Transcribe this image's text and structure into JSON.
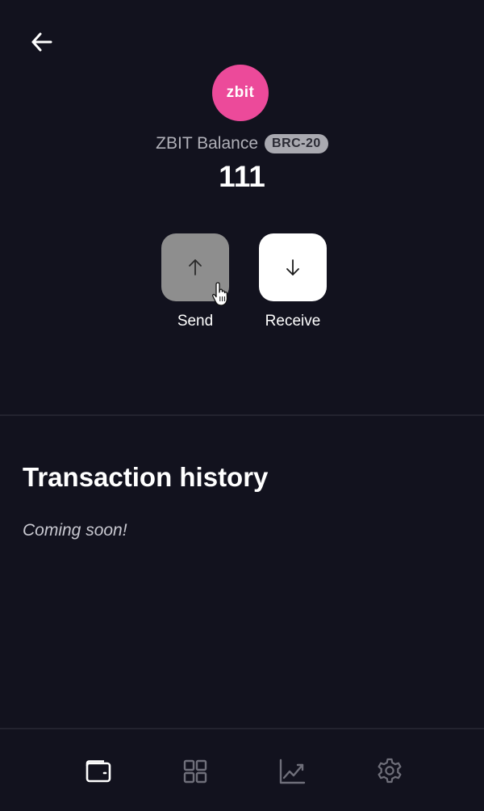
{
  "header": {
    "back_icon": "arrow-left-icon"
  },
  "token": {
    "logo_text": "zbit",
    "logo_color": "#ec4a9a",
    "balance_label": "ZBIT Balance",
    "standard_badge": "BRC-20",
    "balance_amount": "111"
  },
  "actions": {
    "send_label": "Send",
    "send_icon": "arrow-up-icon",
    "receive_label": "Receive",
    "receive_icon": "arrow-down-icon"
  },
  "history": {
    "title": "Transaction history",
    "empty_message": "Coming soon!"
  },
  "bottom_nav": {
    "items": [
      {
        "icon": "wallet-icon",
        "active": true
      },
      {
        "icon": "apps-grid-icon",
        "active": false
      },
      {
        "icon": "chart-icon",
        "active": false
      },
      {
        "icon": "gear-icon",
        "active": false
      }
    ]
  },
  "colors": {
    "background": "#12121e",
    "active_icon": "#ffffff",
    "inactive_icon": "#6f6f7a"
  }
}
